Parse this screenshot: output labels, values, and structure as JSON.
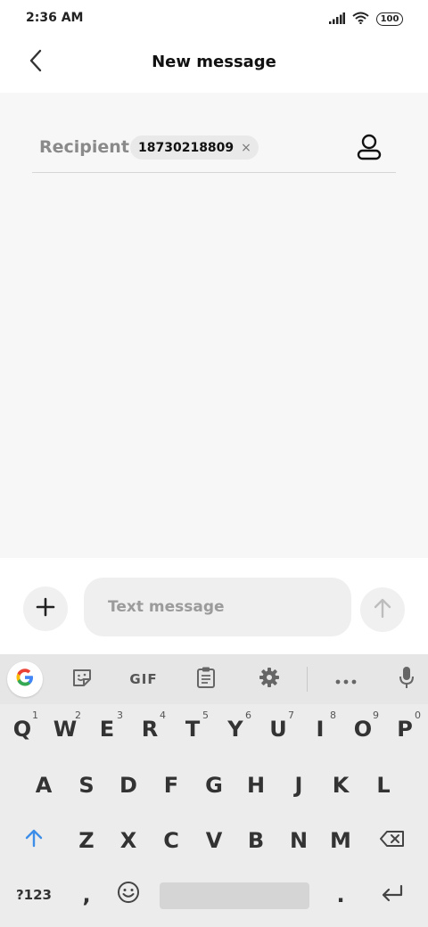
{
  "status": {
    "time": "2:36 AM",
    "battery": "100",
    "icons": [
      "signal-icon",
      "wifi-icon",
      "battery-icon"
    ]
  },
  "header": {
    "title": "New message",
    "back_icon": "chevron-left-icon"
  },
  "recipient": {
    "label": "Recipient:",
    "chip_value": "18730218809",
    "chip_remove": "×",
    "contact_icon": "contact-person-icon"
  },
  "compose": {
    "placeholder": "Text message",
    "value": "",
    "add_icon": "plus-icon",
    "send_icon": "send-arrow-icon"
  },
  "keyboard": {
    "toolbar": {
      "gif_label": "GIF",
      "items": [
        "google-icon",
        "sticker-icon",
        "gif",
        "clipboard-icon",
        "settings-icon",
        "more-icon",
        "mic-icon"
      ]
    },
    "row1": [
      {
        "key": "Q",
        "hint": "1"
      },
      {
        "key": "W",
        "hint": "2"
      },
      {
        "key": "E",
        "hint": "3"
      },
      {
        "key": "R",
        "hint": "4"
      },
      {
        "key": "T",
        "hint": "5"
      },
      {
        "key": "Y",
        "hint": "6"
      },
      {
        "key": "U",
        "hint": "7"
      },
      {
        "key": "I",
        "hint": "8"
      },
      {
        "key": "O",
        "hint": "9"
      },
      {
        "key": "P",
        "hint": "0"
      }
    ],
    "row2": [
      "A",
      "S",
      "D",
      "F",
      "G",
      "H",
      "J",
      "K",
      "L"
    ],
    "row3": [
      "Z",
      "X",
      "C",
      "V",
      "B",
      "N",
      "M"
    ],
    "row4": {
      "symbols": "?123",
      "comma": ",",
      "period": "."
    }
  },
  "colors": {
    "accent_blue": "#3d8ee8",
    "main_bg": "#f7f7f7",
    "keyboard_bg": "#ececec"
  }
}
